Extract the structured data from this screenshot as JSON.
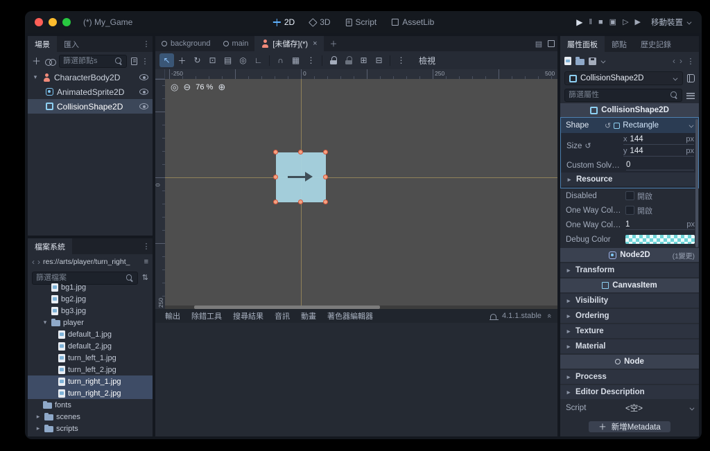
{
  "window": {
    "title": "(*) My_Game"
  },
  "titlebar": {
    "mode_tabs": [
      {
        "label": "2D"
      },
      {
        "label": "3D"
      },
      {
        "label": "Script"
      },
      {
        "label": "AssetLib"
      }
    ],
    "renderer": "移動裝置"
  },
  "scene_dock": {
    "tabs": [
      {
        "label": "場景"
      },
      {
        "label": "匯入"
      }
    ],
    "filter_placeholder": "篩選節點s",
    "nodes": [
      {
        "label": "CharacterBody2D"
      },
      {
        "label": "AnimatedSprite2D"
      },
      {
        "label": "CollisionShape2D"
      }
    ]
  },
  "filesystem_dock": {
    "tab": "檔案系統",
    "path": "res://arts/player/turn_right_",
    "filter_placeholder": "篩選檔案",
    "files": [
      {
        "label": "bg1.jpg"
      },
      {
        "label": "bg2.jpg"
      },
      {
        "label": "bg3.jpg"
      },
      {
        "label": "player"
      },
      {
        "label": "default_1.jpg"
      },
      {
        "label": "default_2.jpg"
      },
      {
        "label": "turn_left_1.jpg"
      },
      {
        "label": "turn_left_2.jpg"
      },
      {
        "label": "turn_right_1.jpg"
      },
      {
        "label": "turn_right_2.jpg"
      },
      {
        "label": "fonts"
      },
      {
        "label": "scenes"
      },
      {
        "label": "scripts"
      }
    ]
  },
  "main": {
    "scene_tabs": [
      {
        "label": "background"
      },
      {
        "label": "main"
      },
      {
        "label": "[未儲存](*)"
      }
    ],
    "view_menu": "檢視",
    "zoom": "76 %",
    "ruler_top": [
      "-250",
      "0",
      "250",
      "500"
    ],
    "ruler_left": [
      "0",
      "250"
    ],
    "bottom_tabs": [
      "輸出",
      "除錯工具",
      "搜尋結果",
      "音訊",
      "動畫",
      "著色器編輯器"
    ],
    "version": "4.1.1.stable"
  },
  "inspector": {
    "tabs": [
      "屬性面板",
      "節點",
      "歷史記錄"
    ],
    "node_name": "CollisionShape2D",
    "filter_placeholder": "篩選屬性",
    "categories": {
      "c1": "CollisionShape2D",
      "c2": "Node2D",
      "c2_note": "(1變更)",
      "c3": "CanvasItem",
      "c4": "Node"
    },
    "props": {
      "shape_label": "Shape",
      "shape_value": "Rectangle",
      "size_label": "Size",
      "size_x_label": "x",
      "size_x": "144",
      "size_y_label": "y",
      "size_y": "144",
      "px": "px",
      "custom_solver_label": "Custom Solver ...",
      "custom_solver_value": "0",
      "resource_label": "Resource",
      "disabled_label": "Disabled",
      "on_label": "開啟",
      "one_way_label": "One Way Collisi...",
      "one_way2_label": "One Way Collisi...",
      "one_way2_value": "1",
      "debug_color_label": "Debug Color",
      "script_label": "Script",
      "script_value": "<空>"
    },
    "sections": {
      "transform": "Transform",
      "visibility": "Visibility",
      "ordering": "Ordering",
      "texture": "Texture",
      "material": "Material",
      "process": "Process",
      "editor_description": "Editor Description"
    },
    "add_metadata": "新增Metadata"
  }
}
